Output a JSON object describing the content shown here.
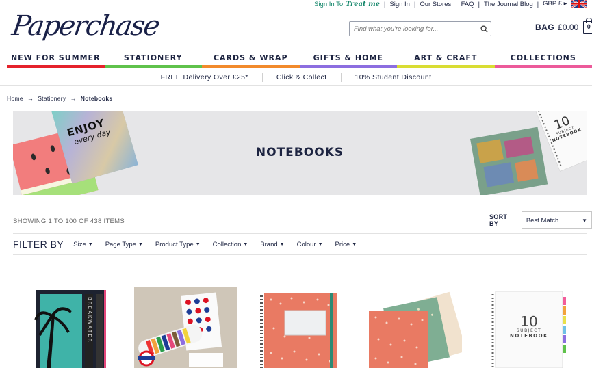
{
  "utility_nav": {
    "sign_in_to": "Sign In To",
    "treat_me": "Treat me",
    "sign_in": "Sign In",
    "our_stores": "Our Stores",
    "faq": "FAQ",
    "journal": "The Journal Blog",
    "currency": "GBP £ ▸",
    "flag_icon": "uk-flag-icon"
  },
  "logo": {
    "text": "Paperchase"
  },
  "search": {
    "placeholder": "Find what you're looking for...",
    "icon": "search-icon"
  },
  "bag": {
    "label": "BAG",
    "total": "£0.00",
    "count": "0",
    "icon": "bag-icon"
  },
  "main_nav": [
    {
      "label": "NEW FOR SUMMER",
      "color": "#e5222b"
    },
    {
      "label": "STATIONERY",
      "color": "#5fc24b"
    },
    {
      "label": "CARDS & WRAP",
      "color": "#f28a2b"
    },
    {
      "label": "GIFTS & HOME",
      "color": "#8c6ee0"
    },
    {
      "label": "ART & CRAFT",
      "color": "#d9dd33"
    },
    {
      "label": "COLLECTIONS",
      "color": "#ec5a9a"
    }
  ],
  "delivery_bar": [
    {
      "label": "FREE Delivery Over £25*"
    },
    {
      "label": "Click & Collect"
    },
    {
      "label": "10% Student Discount"
    }
  ],
  "breadcrumb": [
    {
      "label": "Home"
    },
    {
      "label": "Stationery"
    },
    {
      "label": "Notebooks"
    }
  ],
  "hero": {
    "title": "NOTEBOOKS",
    "left_notebook_text_1": "ENJOY",
    "left_notebook_text_2": "every day",
    "right_notebook_number": "10",
    "right_notebook_text_1": "SUBJECT",
    "right_notebook_text_2": "NOTEBOOK"
  },
  "results": {
    "label": "SHOWING 1 TO 100 OF 438 ITEMS"
  },
  "sort": {
    "label": "SORT BY",
    "selected": "Best Match"
  },
  "filter": {
    "label": "FILTER BY",
    "options": [
      {
        "label": "Size"
      },
      {
        "label": "Page Type"
      },
      {
        "label": "Product Type"
      },
      {
        "label": "Collection"
      },
      {
        "label": "Brand"
      },
      {
        "label": "Colour"
      },
      {
        "label": "Price"
      }
    ]
  },
  "products": [
    {
      "name": "palm-tree-notebook",
      "label_text": "BREAKWATER"
    },
    {
      "name": "london-underground-notebook-set"
    },
    {
      "name": "coral-spiral-notebook"
    },
    {
      "name": "patterned-notebooks-trio"
    },
    {
      "name": "ten-subject-notebook",
      "number": "10",
      "text_1": "SUBJECT",
      "text_2": "NOTEBOOK"
    }
  ]
}
